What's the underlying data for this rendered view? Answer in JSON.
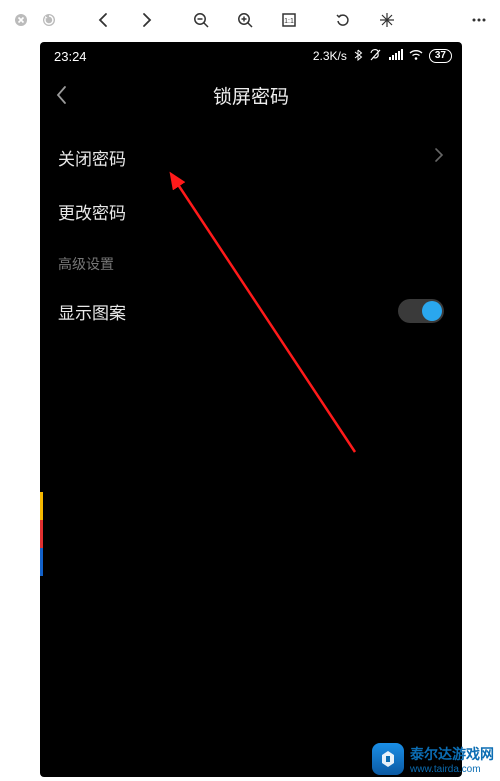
{
  "status": {
    "time": "23:24",
    "net_speed": "2.3K/s",
    "battery": "37"
  },
  "header": {
    "title": "锁屏密码"
  },
  "rows": {
    "disable_password": "关闭密码",
    "change_password": "更改密码",
    "section_advanced": "高级设置",
    "show_pattern": "显示图案"
  },
  "watermark": {
    "name": "泰尔达游戏网",
    "url": "www.tairda.com"
  }
}
